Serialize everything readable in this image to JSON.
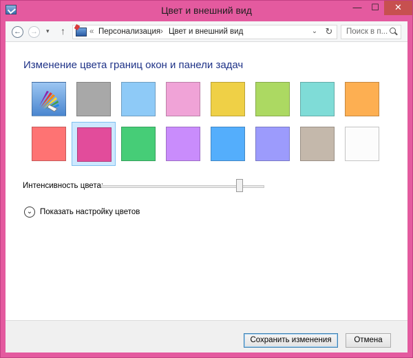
{
  "window": {
    "title": "Цвет и внешний вид",
    "controls": {
      "minimize": "—",
      "maximize": "☐",
      "close": "✕"
    }
  },
  "navbar": {
    "back_icon": "←",
    "forward_icon": "→",
    "recent_icon": "▾",
    "up_icon": "↑",
    "overflow": "«",
    "breadcrumb": [
      "Персонализация",
      "Цвет и внешний вид"
    ],
    "separator": "›",
    "dropdown_icon": "⌄",
    "refresh_icon": "↻",
    "search_placeholder": "Поиск в п..."
  },
  "content": {
    "heading": "Изменение цвета границ окон и панели задач",
    "colors": [
      {
        "name": "automatic",
        "hex": "#6fa8e6",
        "selected": false
      },
      {
        "name": "gray",
        "hex": "#a8a8a8",
        "selected": false
      },
      {
        "name": "light-blue",
        "hex": "#8ecaf7",
        "selected": false
      },
      {
        "name": "pink",
        "hex": "#f0a3d7",
        "selected": false
      },
      {
        "name": "yellow",
        "hex": "#efd046",
        "selected": false
      },
      {
        "name": "lime",
        "hex": "#acd962",
        "selected": false
      },
      {
        "name": "teal",
        "hex": "#7fdcd7",
        "selected": false
      },
      {
        "name": "orange",
        "hex": "#fdaf52",
        "selected": false
      },
      {
        "name": "red",
        "hex": "#fe7373",
        "selected": false
      },
      {
        "name": "magenta",
        "hex": "#e24c9b",
        "selected": true
      },
      {
        "name": "green",
        "hex": "#46cd77",
        "selected": false
      },
      {
        "name": "violet",
        "hex": "#c98cfc",
        "selected": false
      },
      {
        "name": "blue",
        "hex": "#54aefc",
        "selected": false
      },
      {
        "name": "periwinkle",
        "hex": "#9c9bfc",
        "selected": false
      },
      {
        "name": "taupe",
        "hex": "#c4b8ab",
        "selected": false
      },
      {
        "name": "white",
        "hex": "#fcfcfc",
        "selected": false
      }
    ],
    "intensity_label": "Интенсивность цвета:",
    "intensity_value": 0.85,
    "expand_icon": "⌄",
    "expand_label": "Показать настройку цветов"
  },
  "footer": {
    "save_label": "Сохранить изменения",
    "cancel_label": "Отмена"
  }
}
